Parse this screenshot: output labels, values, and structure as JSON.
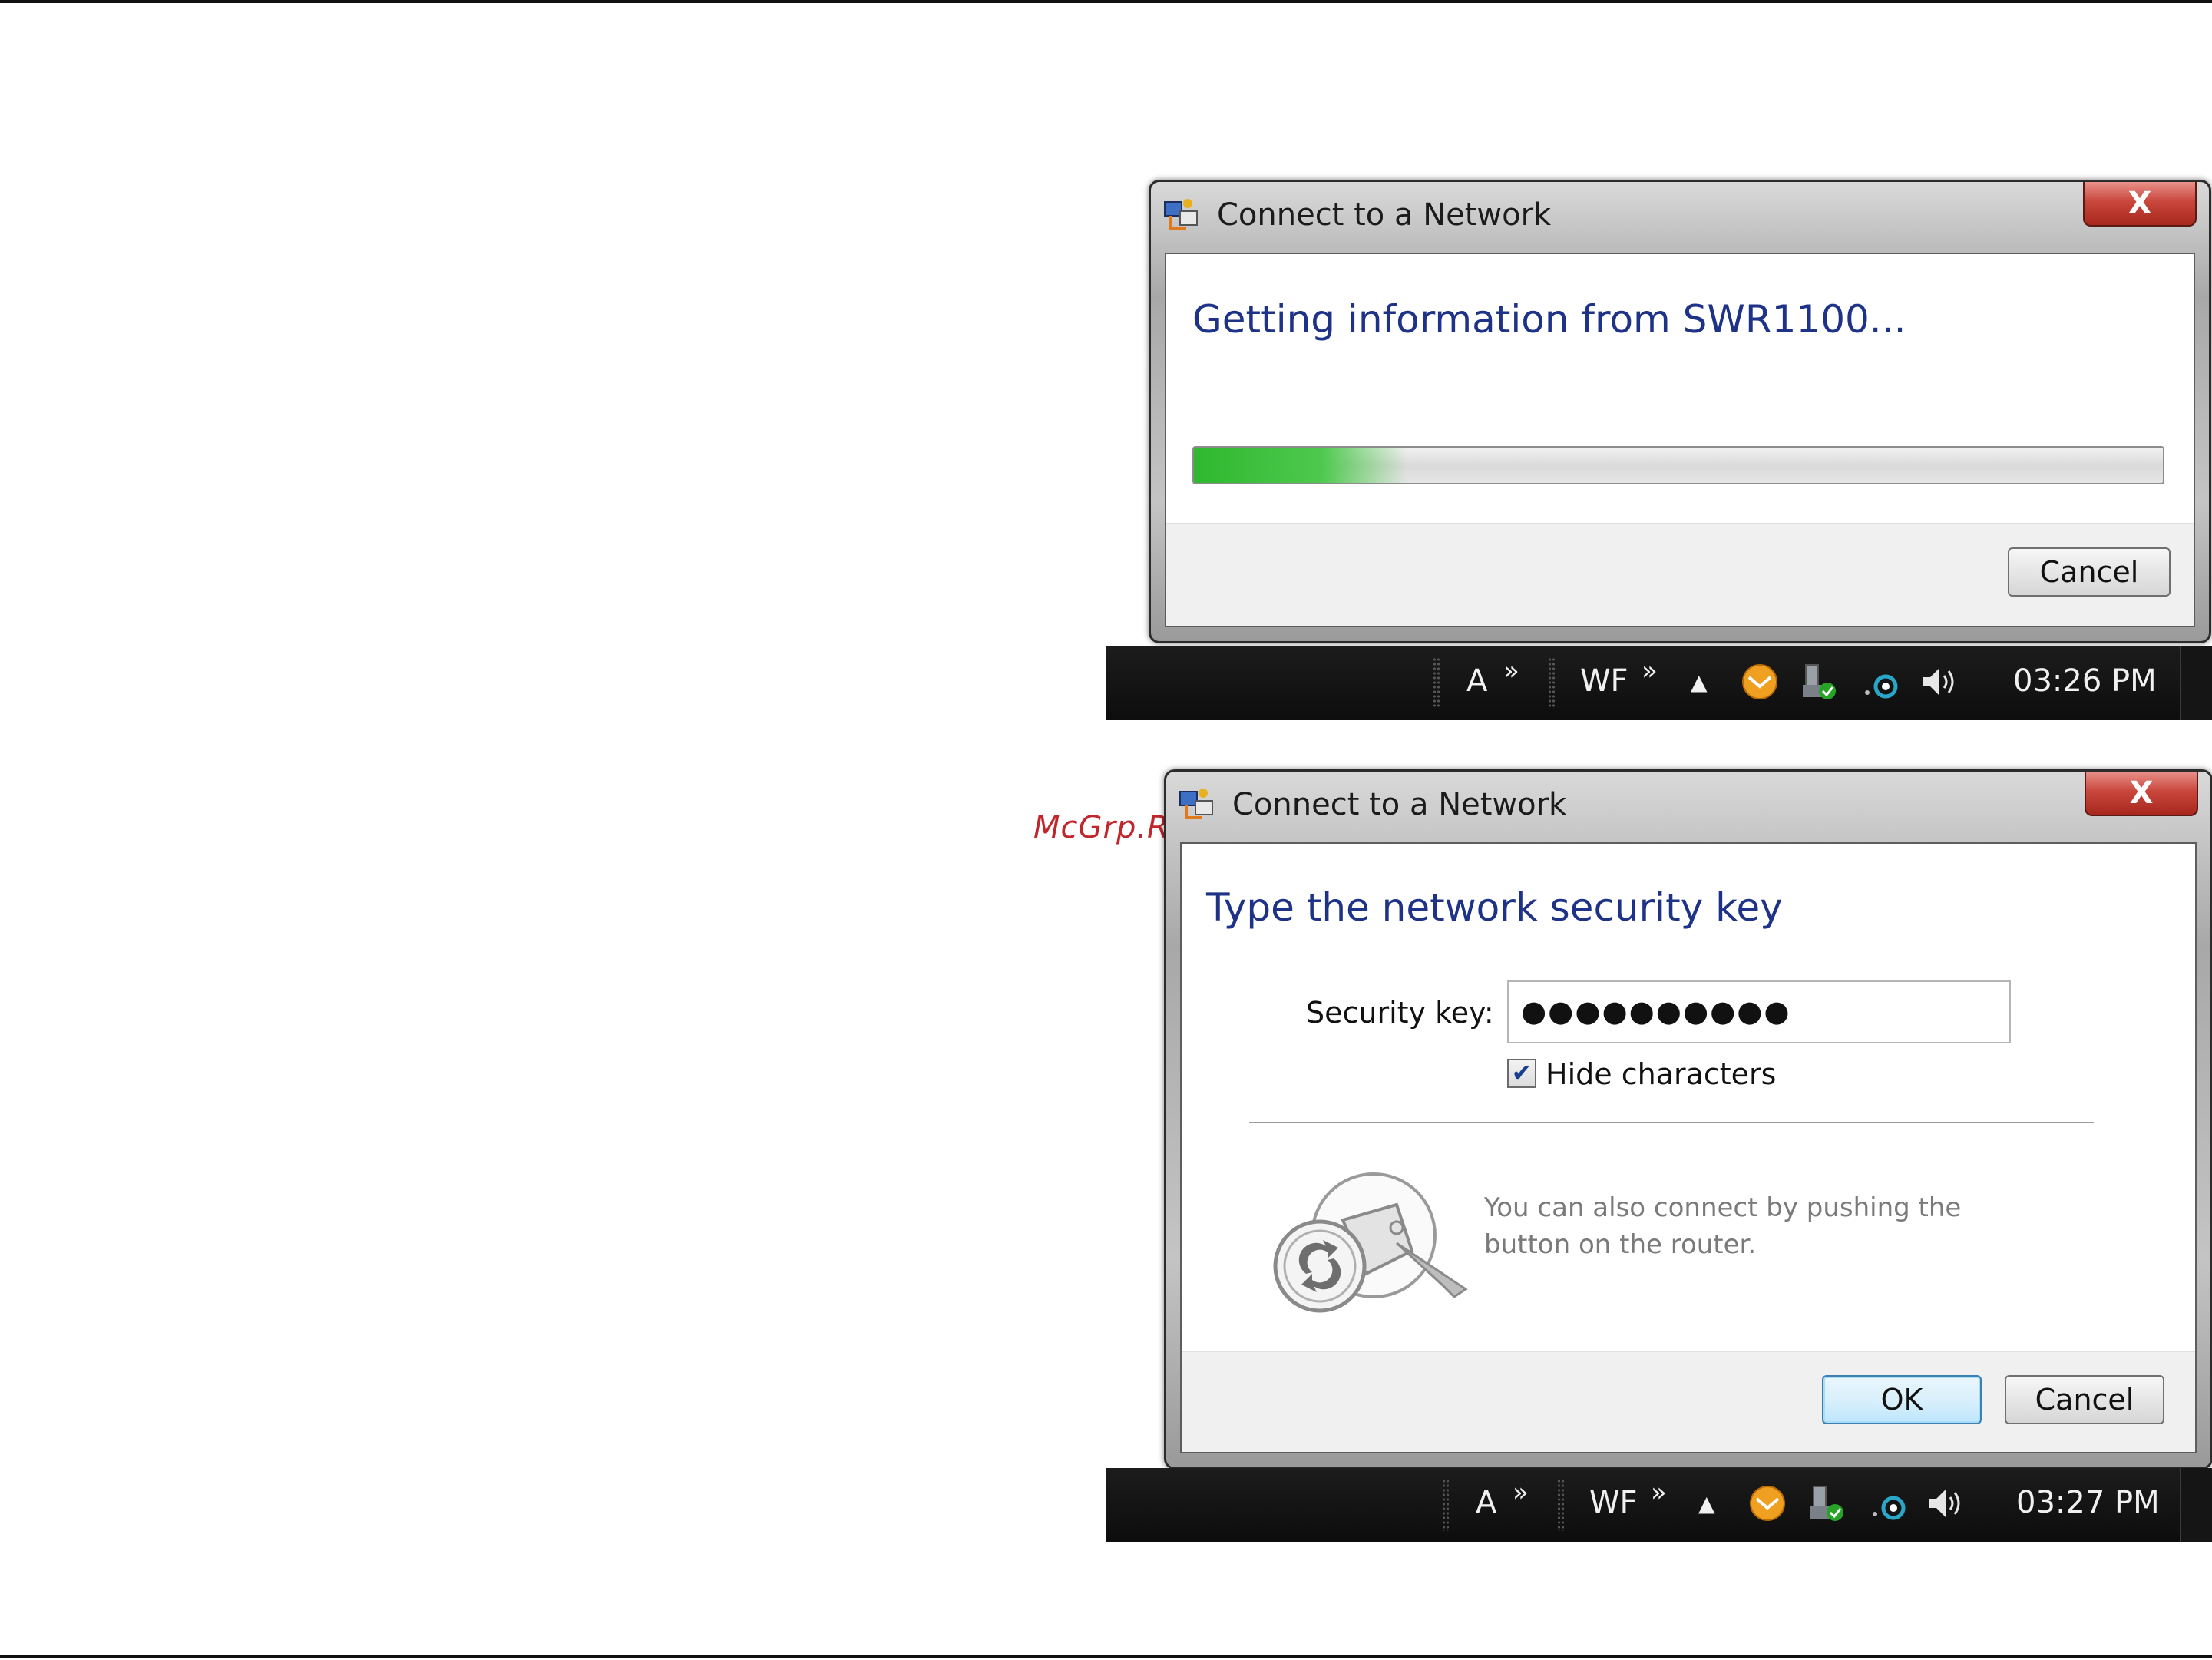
{
  "watermark": "McGrp.Ru",
  "dialog1": {
    "title": "Connect to a Network",
    "close_label": "X",
    "heading": "Getting information from SWR1100...",
    "progress": 0.22,
    "cancel_label": "Cancel"
  },
  "taskbar1": {
    "lang": "A",
    "chev1": "»",
    "wf": "WF",
    "chev2": "»",
    "tray_arrow": "▲",
    "clock": "03:26 PM"
  },
  "dialog2": {
    "title": "Connect to a Network",
    "close_label": "X",
    "heading": "Type the network security key",
    "security_key_label": "Security key:",
    "security_key_value": "●●●●●●●●●●",
    "hide_characters_checked": true,
    "hide_characters_label": "Hide characters",
    "wps_text": "You can also connect by pushing the button on the router.",
    "ok_label": "OK",
    "cancel_label": "Cancel"
  },
  "taskbar2": {
    "lang": "A",
    "chev1": "»",
    "wf": "WF",
    "chev2": "»",
    "tray_arrow": "▲",
    "clock": "03:27 PM"
  },
  "icons": [
    "network-icon",
    "close-icon",
    "messenger-icon",
    "usb-safe-remove-icon",
    "network-tray-icon",
    "volume-icon",
    "wps-router-icon"
  ],
  "colors": {
    "heading": "#1e3287",
    "progress": "#2fb82f",
    "taskbar": "#0d0d0d",
    "close": "#c9473d"
  }
}
